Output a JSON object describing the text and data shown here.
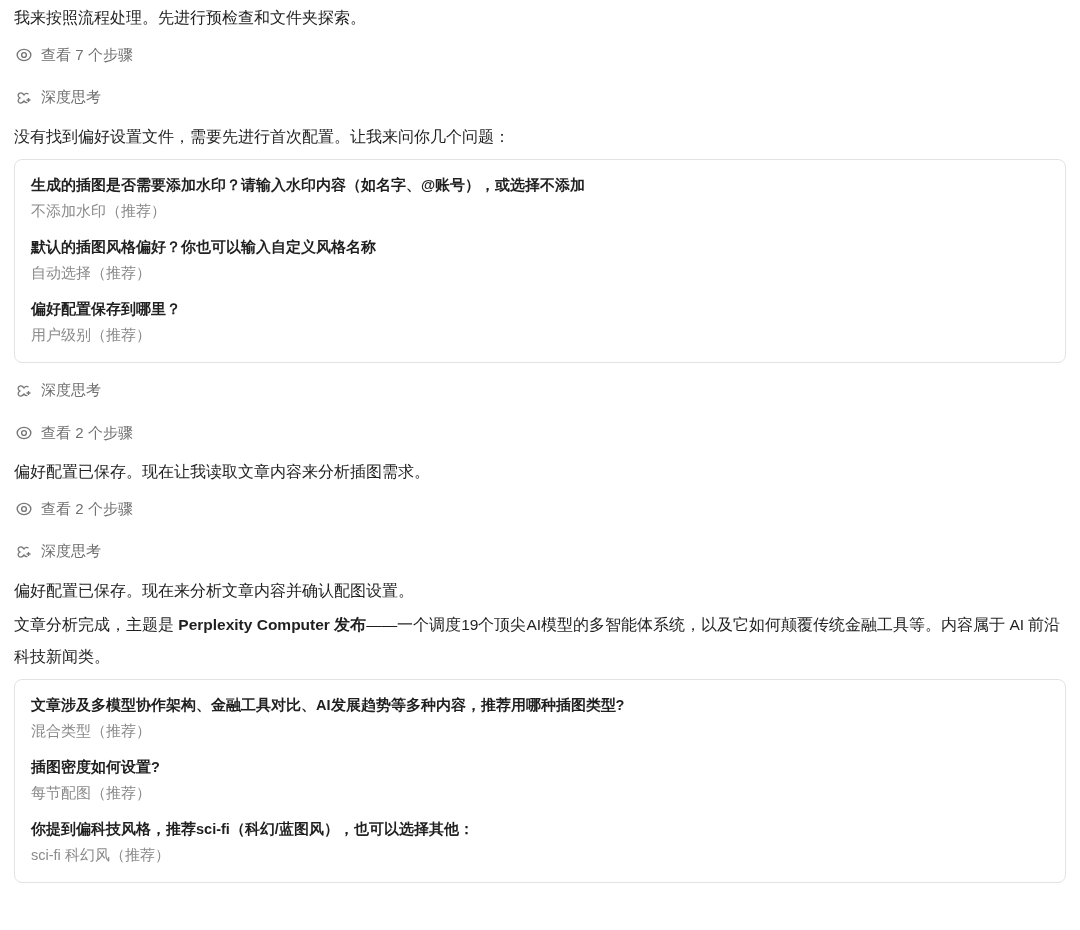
{
  "messages": [
    {
      "kind": "text",
      "text": "我来按照流程处理。先进行预检查和文件夹探索。"
    },
    {
      "kind": "steps",
      "text": "查看 7 个步骤"
    },
    {
      "kind": "thinking",
      "text": "深度思考"
    },
    {
      "kind": "text",
      "text": "没有找到偏好设置文件，需要先进行首次配置。让我来问你几个问题："
    },
    {
      "kind": "questions",
      "questions": [
        {
          "question": "生成的插图是否需要添加水印？请输入水印内容（如名字、@账号），或选择不添加",
          "answer": "不添加水印（推荐）"
        },
        {
          "question": "默认的插图风格偏好？你也可以输入自定义风格名称",
          "answer": "自动选择（推荐）"
        },
        {
          "question": "偏好配置保存到哪里？",
          "answer": "用户级别（推荐）"
        }
      ]
    },
    {
      "kind": "thinking",
      "text": "深度思考"
    },
    {
      "kind": "steps",
      "text": "查看 2 个步骤"
    },
    {
      "kind": "text",
      "text": "偏好配置已保存。现在让我读取文章内容来分析插图需求。"
    },
    {
      "kind": "steps",
      "text": "查看 2 个步骤"
    },
    {
      "kind": "thinking",
      "text": "深度思考"
    },
    {
      "kind": "text",
      "text": "偏好配置已保存。现在来分析文章内容并确认配图设置。"
    },
    {
      "kind": "text",
      "text": "文章分析完成，主题是 **Perplexity Computer 发布**——一个调度19个顶尖AI模型的多智能体系统，以及它如何颠覆传统金融工具等。内容属于 AI 前沿科技新闻类。"
    },
    {
      "kind": "questions",
      "questions": [
        {
          "question": "文章涉及多模型协作架构、金融工具对比、AI发展趋势等多种内容，推荐用哪种插图类型?",
          "answer": "混合类型（推荐）"
        },
        {
          "question": "插图密度如何设置?",
          "answer": "每节配图（推荐）"
        },
        {
          "question": "你提到偏科技风格，推荐sci-fi（科幻/蓝图风），也可以选择其他：",
          "answer": "sci-fi 科幻风（推荐）"
        }
      ]
    }
  ]
}
